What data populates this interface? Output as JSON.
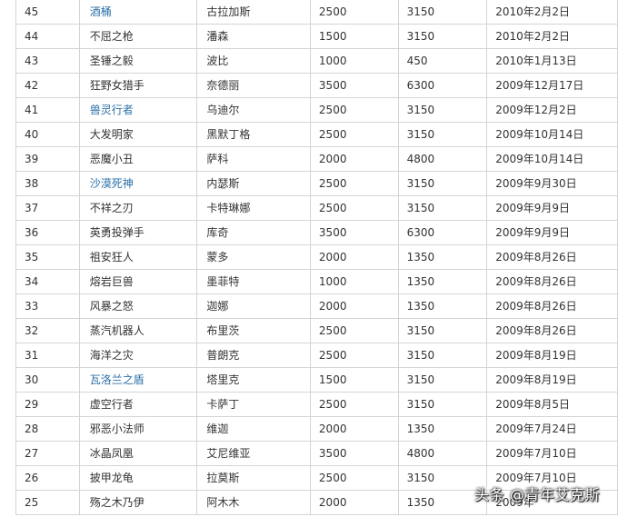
{
  "rows": [
    {
      "num": "45",
      "name": "酒桶",
      "title": "古拉加斯",
      "ip": "2500",
      "rp": "3150",
      "date": "2010年2月2日",
      "link": true
    },
    {
      "num": "44",
      "name": "不屈之枪",
      "title": "潘森",
      "ip": "1500",
      "rp": "3150",
      "date": "2010年2月2日",
      "link": false
    },
    {
      "num": "43",
      "name": "圣锤之毅",
      "title": "波比",
      "ip": "1000",
      "rp": "450",
      "date": "2010年1月13日",
      "link": false
    },
    {
      "num": "42",
      "name": "狂野女猎手",
      "title": "奈德丽",
      "ip": "3500",
      "rp": "6300",
      "date": "2009年12月17日",
      "link": false
    },
    {
      "num": "41",
      "name": "兽灵行者",
      "title": "乌迪尔",
      "ip": "2500",
      "rp": "3150",
      "date": "2009年12月2日",
      "link": true
    },
    {
      "num": "40",
      "name": "大发明家",
      "title": "黑默丁格",
      "ip": "2500",
      "rp": "3150",
      "date": "2009年10月14日",
      "link": false
    },
    {
      "num": "39",
      "name": "恶魔小丑",
      "title": "萨科",
      "ip": "2000",
      "rp": "4800",
      "date": "2009年10月14日",
      "link": false
    },
    {
      "num": "38",
      "name": "沙漠死神",
      "title": "内瑟斯",
      "ip": "2500",
      "rp": "3150",
      "date": "2009年9月30日",
      "link": true
    },
    {
      "num": "37",
      "name": "不祥之刃",
      "title": "卡特琳娜",
      "ip": "2500",
      "rp": "3150",
      "date": "2009年9月9日",
      "link": false
    },
    {
      "num": "36",
      "name": "英勇投弹手",
      "title": "库奇",
      "ip": "3500",
      "rp": "6300",
      "date": "2009年9月9日",
      "link": false
    },
    {
      "num": "35",
      "name": "祖安狂人",
      "title": "蒙多",
      "ip": "2000",
      "rp": "1350",
      "date": "2009年8月26日",
      "link": false
    },
    {
      "num": "34",
      "name": "熔岩巨兽",
      "title": "墨菲特",
      "ip": "1000",
      "rp": "1350",
      "date": "2009年8月26日",
      "link": false
    },
    {
      "num": "33",
      "name": "风暴之怒",
      "title": "迦娜",
      "ip": "2000",
      "rp": "1350",
      "date": "2009年8月26日",
      "link": false
    },
    {
      "num": "32",
      "name": "蒸汽机器人",
      "title": "布里茨",
      "ip": "2500",
      "rp": "3150",
      "date": "2009年8月26日",
      "link": false
    },
    {
      "num": "31",
      "name": "海洋之灾",
      "title": "普朗克",
      "ip": "2500",
      "rp": "3150",
      "date": "2009年8月19日",
      "link": false
    },
    {
      "num": "30",
      "name": "瓦洛兰之盾",
      "title": "塔里克",
      "ip": "1500",
      "rp": "3150",
      "date": "2009年8月19日",
      "link": true
    },
    {
      "num": "29",
      "name": "虚空行者",
      "title": "卡萨丁",
      "ip": "2500",
      "rp": "3150",
      "date": "2009年8月5日",
      "link": false
    },
    {
      "num": "28",
      "name": "邪恶小法师",
      "title": "维迦",
      "ip": "2000",
      "rp": "1350",
      "date": "2009年7月24日",
      "link": false
    },
    {
      "num": "27",
      "name": "冰晶凤凰",
      "title": "艾尼维亚",
      "ip": "3500",
      "rp": "4800",
      "date": "2009年7月10日",
      "link": false
    },
    {
      "num": "26",
      "name": "披甲龙龟",
      "title": "拉莫斯",
      "ip": "2500",
      "rp": "3150",
      "date": "2009年7月10日",
      "link": false
    },
    {
      "num": "25",
      "name": "殇之木乃伊",
      "title": "阿木木",
      "ip": "2000",
      "rp": "1350",
      "date": "2009年",
      "link": false
    }
  ],
  "watermark": {
    "prefix": "头条",
    "handle": "@青年艾克斯"
  }
}
